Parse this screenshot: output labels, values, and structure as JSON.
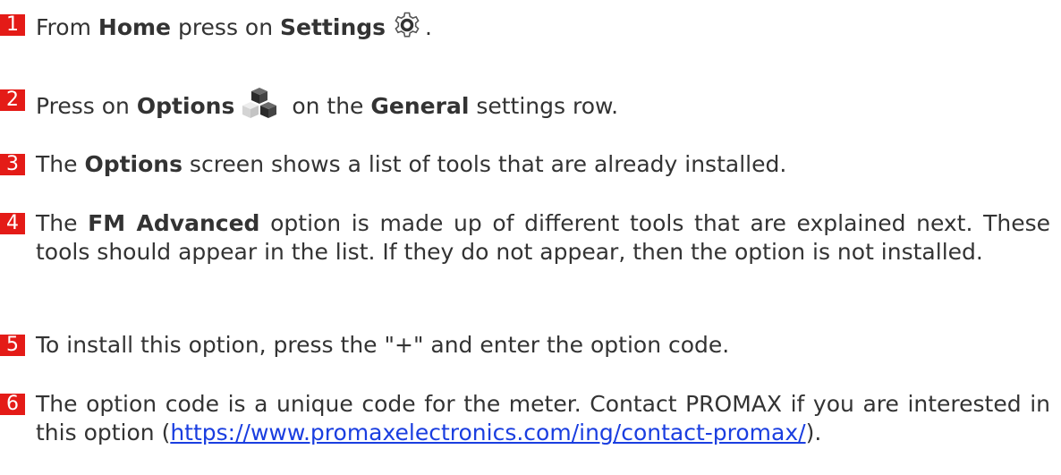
{
  "badge_color": "#e41b17",
  "steps": [
    {
      "number": "1",
      "t1": "From ",
      "b1": "Home",
      "t2": " press on ",
      "b2": "Settings",
      "icon": "gear-icon",
      "t3": "."
    },
    {
      "number": "2",
      "t1": "Press on ",
      "b1": "Options",
      "icon": "cubes-icon",
      "t2": " on the ",
      "b2": "General",
      "t3": " settings row."
    },
    {
      "number": "3",
      "t1": "The ",
      "b1": "Options",
      "t2": " screen shows a list of tools that are already installed."
    },
    {
      "number": "4",
      "t1": "The ",
      "b1": "FM Advanced",
      "t2": " option is made up of different tools that are explained next. These tools should appear in the list. If they do not appear, then the option is not installed."
    },
    {
      "number": "5",
      "t1": "To install this option, press the \"+\" and enter the option code."
    },
    {
      "number": "6",
      "t1": "The option code is a unique code for the meter. Contact PROMAX if you are interested in this option (",
      "link": "https://www.promaxelectronics.com/ing/contact-promax/",
      "t2": ")."
    }
  ]
}
